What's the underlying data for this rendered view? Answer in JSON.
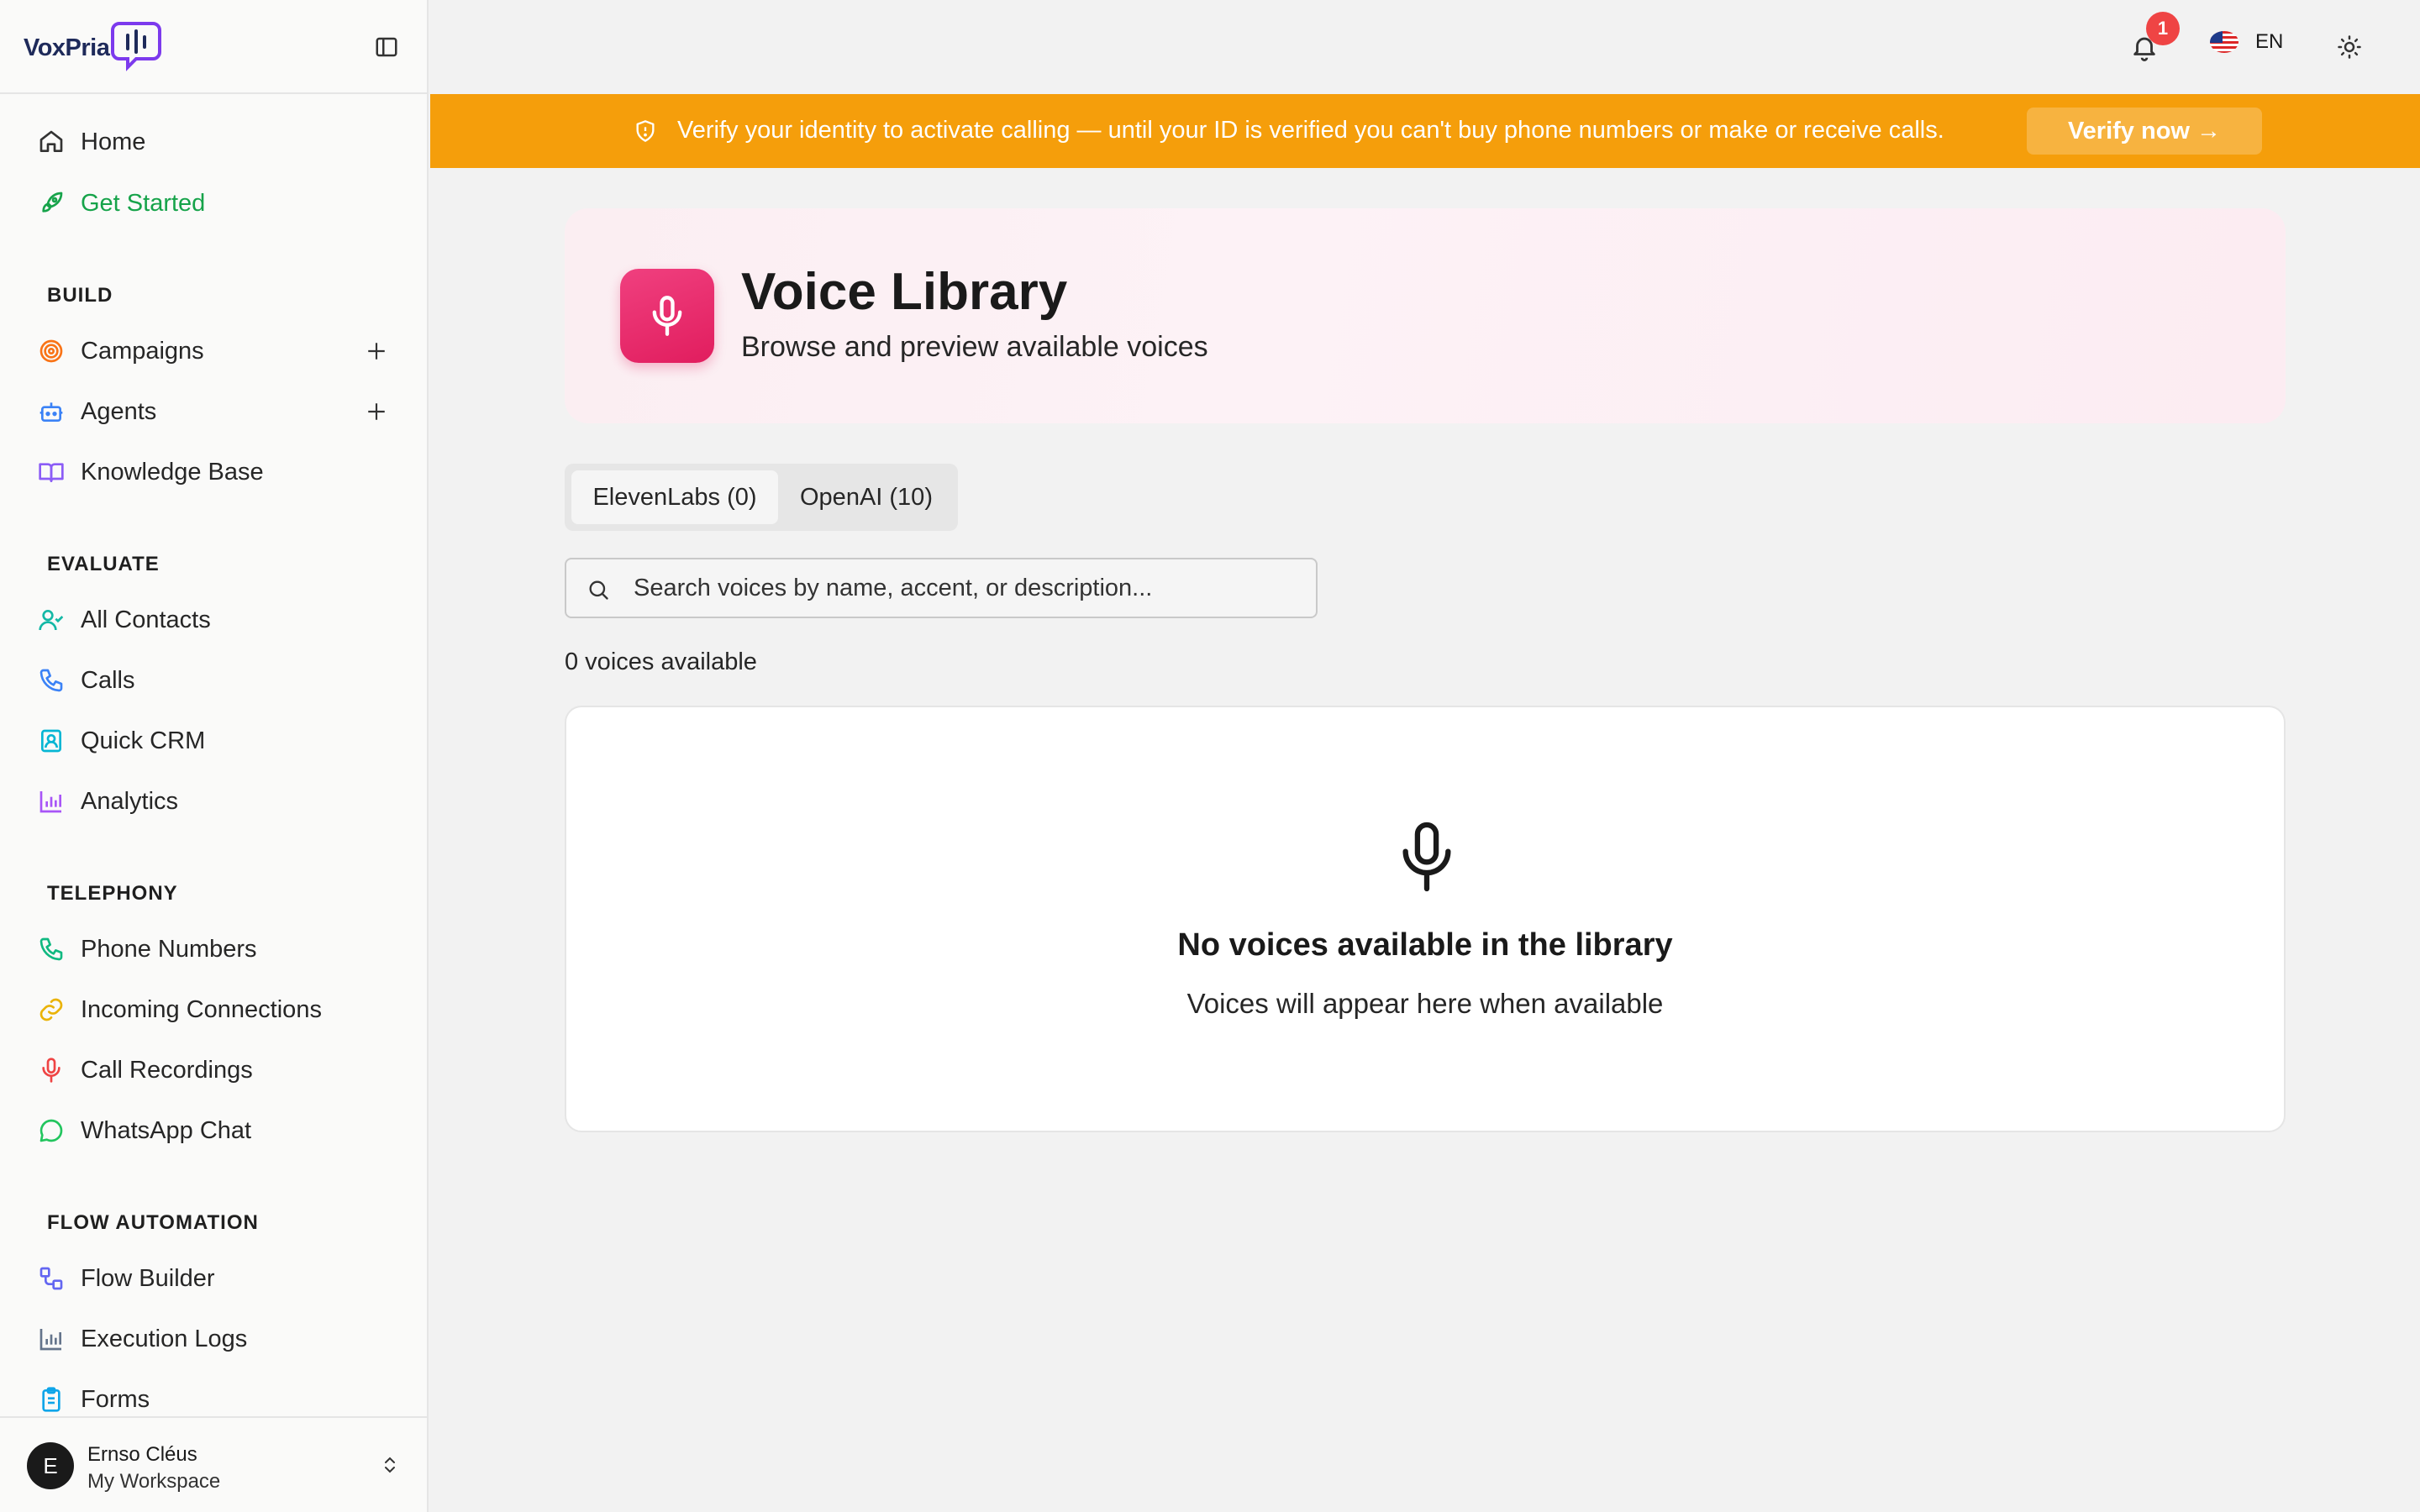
{
  "app": {
    "logo_text": "VoxPria",
    "brand_color": "#1e2a5a"
  },
  "sidebar": {
    "items_top": [
      {
        "label": "Home",
        "icon": "home-icon"
      },
      {
        "label": "Get Started",
        "icon": "rocket-icon"
      }
    ],
    "sections": [
      {
        "title": "BUILD",
        "items": [
          {
            "label": "Campaigns",
            "icon": "target-icon"
          },
          {
            "label": "Agents",
            "icon": "bot-icon"
          },
          {
            "label": "Knowledge Base",
            "icon": "book-icon"
          }
        ]
      },
      {
        "title": "EVALUATE",
        "items": [
          {
            "label": "All Contacts",
            "icon": "user-check-icon"
          },
          {
            "label": "Calls",
            "icon": "phone-icon"
          },
          {
            "label": "Quick CRM",
            "icon": "contact-card-icon"
          },
          {
            "label": "Analytics",
            "icon": "bar-chart-icon"
          }
        ]
      },
      {
        "title": "TELEPHONY",
        "items": [
          {
            "label": "Phone Numbers",
            "icon": "phone-icon"
          },
          {
            "label": "Incoming Connections",
            "icon": "link-icon"
          },
          {
            "label": "Call Recordings",
            "icon": "mic-icon"
          },
          {
            "label": "WhatsApp Chat",
            "icon": "chat-bubble-icon"
          }
        ]
      },
      {
        "title": "FLOW AUTOMATION",
        "items": [
          {
            "label": "Flow Builder",
            "icon": "workflow-icon"
          },
          {
            "label": "Execution Logs",
            "icon": "bar-chart-icon"
          },
          {
            "label": "Forms",
            "icon": "clipboard-icon"
          }
        ]
      }
    ],
    "user": {
      "initial": "E",
      "name": "Ernso Cléus",
      "workspace": "My Workspace"
    }
  },
  "topbar": {
    "notification_count": "1",
    "language": "EN"
  },
  "banner": {
    "text": "Verify your identity to activate calling — until your ID is verified you can't buy phone numbers or make or receive calls.",
    "button": "Verify now →",
    "color": "#f59e0b"
  },
  "main": {
    "title": "Voice Library",
    "subtitle": "Browse and preview available voices",
    "tabs": [
      {
        "label": "ElevenLabs (0)"
      },
      {
        "label": "OpenAI (10)"
      }
    ],
    "search_placeholder": "Search voices by name, accent, or description...",
    "count_text": "0 voices available",
    "empty_title": "No voices available in the library",
    "empty_subtitle": "Voices will appear here when available",
    "accent_color": "#e11d5e"
  }
}
